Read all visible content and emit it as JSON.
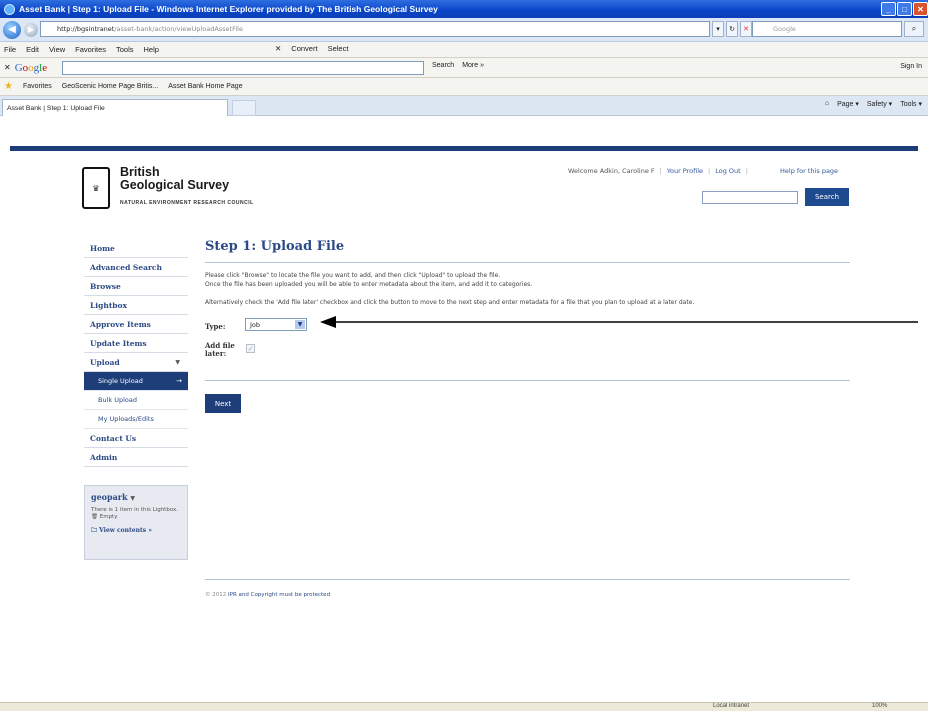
{
  "window": {
    "title": "Asset Bank | Step 1: Upload File - Windows Internet Explorer provided by The British Geological Survey",
    "buttons": [
      "_",
      "□",
      "✕"
    ]
  },
  "browser": {
    "url_host": "http://bgsintranet",
    "url_path": "/asset-bank/action/viewUploadAssetFile",
    "search_placeholder": "Google",
    "menu": [
      "File",
      "Edit",
      "View",
      "Favorites",
      "Tools",
      "Help"
    ],
    "convert_label": "Convert",
    "select_label": "Select",
    "google_search_label": "Search",
    "more_label": "More »",
    "sign_in_label": "Sign In",
    "favorites_label": "Favorites",
    "fav_links": [
      "GeoScenic Home Page Britis...",
      "Asset Bank Home Page"
    ],
    "tab_title": "Asset Bank | Step 1: Upload File",
    "commands": [
      "Page ▾",
      "Safety ▾",
      "Tools ▾"
    ],
    "status_zone": "Local intranet",
    "status_zoom": "100%"
  },
  "header": {
    "org_line1": "British",
    "org_line2": "Geological Survey",
    "org_sub": "NATURAL ENVIRONMENT RESEARCH COUNCIL",
    "welcome": "Welcome Adkin, Caroline F",
    "your_profile": "Your Profile",
    "log_out": "Log Out",
    "help": "Help for this page",
    "search_button": "Search"
  },
  "sidebar": {
    "items": [
      {
        "label": "Home"
      },
      {
        "label": "Advanced Search"
      },
      {
        "label": "Browse"
      },
      {
        "label": "Lightbox"
      },
      {
        "label": "Approve Items"
      },
      {
        "label": "Update Items"
      },
      {
        "label": "Upload"
      }
    ],
    "upload_sub": [
      {
        "label": "Single Upload"
      },
      {
        "label": "Bulk Upload"
      },
      {
        "label": "My Uploads/Edits"
      }
    ],
    "items_after": [
      {
        "label": "Contact Us"
      },
      {
        "label": "Admin"
      }
    ],
    "lightbox": {
      "name": "geopark",
      "text": "There is 1 item in this Lightbox.",
      "empty": "Empty",
      "view": "View contents »"
    }
  },
  "main": {
    "title": "Step 1: Upload File",
    "para1": "Please click \"Browse\" to locate the file you want to add, and then click \"Upload\" to upload the file.",
    "para2": "Once the file has been uploaded you will be able to enter metadata about the item, and add it to categories.",
    "para3": "Alternatively check the 'Add file later' checkbox and click the button to move to the next step and enter metadata for a file that you plan to upload at a later date.",
    "type_label": "Type:",
    "type_value": "Job",
    "add_later_label_1": "Add file",
    "add_later_label_2": "later:",
    "next_button": "Next",
    "footer_copy": "© 2012",
    "footer_link": "IPR and Copyright must be protected"
  }
}
